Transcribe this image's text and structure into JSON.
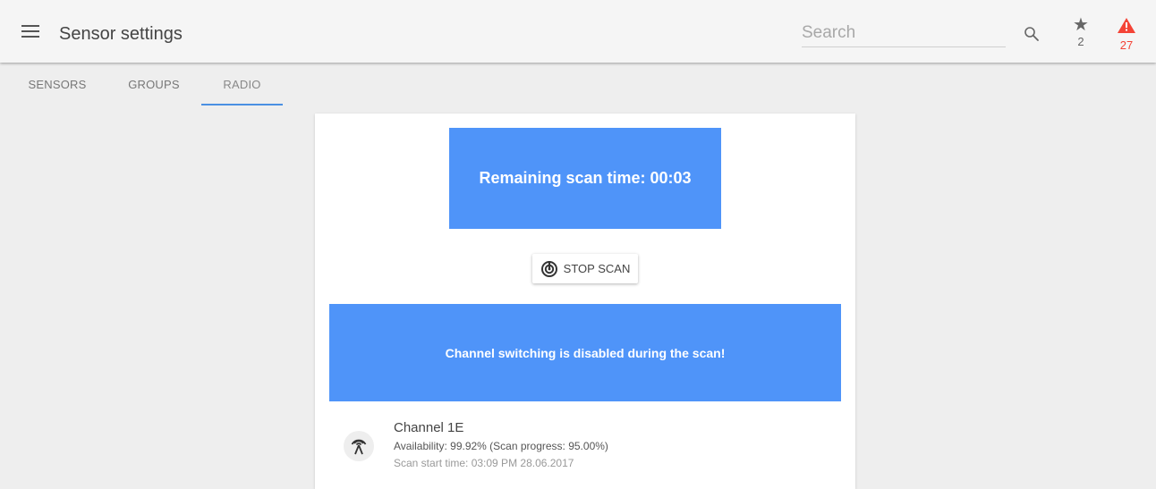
{
  "header": {
    "title": "Sensor settings",
    "search_placeholder": "Search",
    "favorites_count": "2",
    "alerts_count": "27",
    "icons": [
      "menu-icon",
      "search-icon",
      "star-icon",
      "warning-icon"
    ],
    "alert_color": "#f44336"
  },
  "tabs": [
    {
      "label": "SENSORS"
    },
    {
      "label": "GROUPS"
    },
    {
      "label": "RADIO",
      "active": true
    }
  ],
  "scan": {
    "remaining_label": "Remaining scan time: 00:03",
    "stop_label": "STOP SCAN",
    "notice": "Channel switching is disabled during the scan!",
    "accent_color": "#4f94f9"
  },
  "channel": {
    "name": "Channel 1E",
    "availability": "Availability: 99.92% (Scan progress: 95.00%)",
    "start_time": "Scan start time: 03:09 PM 28.06.2017"
  }
}
